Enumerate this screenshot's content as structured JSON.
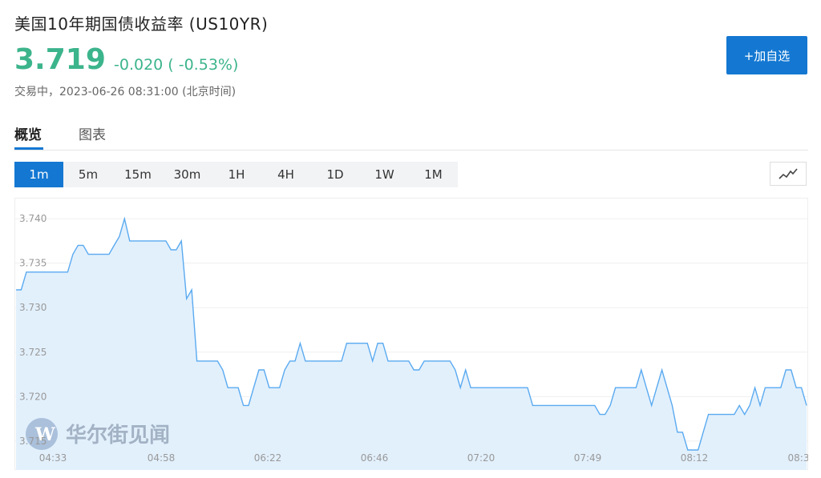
{
  "header": {
    "title": "美国10年期国债收益率 (US10YR)",
    "price": "3.719",
    "change": "-0.020 ( -0.53%)",
    "status": "交易中，2023-06-26 08:31:00 (北京时间)",
    "add_button": "+加自选"
  },
  "tabs": [
    {
      "label": "概览",
      "active": true
    },
    {
      "label": "图表",
      "active": false
    }
  ],
  "periods": [
    {
      "label": "1m",
      "active": true
    },
    {
      "label": "5m",
      "active": false
    },
    {
      "label": "15m",
      "active": false
    },
    {
      "label": "30m",
      "active": false
    },
    {
      "label": "1H",
      "active": false
    },
    {
      "label": "4H",
      "active": false
    },
    {
      "label": "1D",
      "active": false
    },
    {
      "label": "1W",
      "active": false
    },
    {
      "label": "1M",
      "active": false
    }
  ],
  "chart_toggle_icon": "line-chart-icon",
  "watermark": "华尔街见闻",
  "colors": {
    "up_down": "#3cb48c",
    "accent": "#1478d2",
    "line": "#5aaaf0",
    "fill": "#e2f0fc"
  },
  "chart_data": {
    "type": "area",
    "title": "",
    "xlabel": "",
    "ylabel": "",
    "ylim": [
      3.714,
      3.741
    ],
    "yticks": [
      "3.740",
      "3.735",
      "3.730",
      "3.725",
      "3.720",
      "3.715"
    ],
    "xticks": [
      "04:33",
      "04:58",
      "06:22",
      "06:46",
      "07:20",
      "07:49",
      "08:12",
      "08:3"
    ],
    "grid": true,
    "values": [
      3.732,
      3.732,
      3.734,
      3.734,
      3.734,
      3.734,
      3.734,
      3.734,
      3.734,
      3.734,
      3.734,
      3.736,
      3.737,
      3.737,
      3.736,
      3.736,
      3.736,
      3.736,
      3.736,
      3.737,
      3.738,
      3.74,
      3.7375,
      3.7375,
      3.7375,
      3.7375,
      3.7375,
      3.7375,
      3.7375,
      3.7375,
      3.7365,
      3.7365,
      3.7375,
      3.731,
      3.732,
      3.724,
      3.724,
      3.724,
      3.724,
      3.724,
      3.723,
      3.721,
      3.721,
      3.721,
      3.719,
      3.719,
      3.721,
      3.723,
      3.723,
      3.721,
      3.721,
      3.721,
      3.723,
      3.724,
      3.724,
      3.726,
      3.724,
      3.724,
      3.724,
      3.724,
      3.724,
      3.724,
      3.724,
      3.724,
      3.726,
      3.726,
      3.726,
      3.726,
      3.726,
      3.724,
      3.726,
      3.726,
      3.724,
      3.724,
      3.724,
      3.724,
      3.724,
      3.723,
      3.723,
      3.724,
      3.724,
      3.724,
      3.724,
      3.724,
      3.724,
      3.723,
      3.721,
      3.723,
      3.721,
      3.721,
      3.721,
      3.721,
      3.721,
      3.721,
      3.721,
      3.721,
      3.721,
      3.721,
      3.721,
      3.721,
      3.719,
      3.719,
      3.719,
      3.719,
      3.719,
      3.719,
      3.719,
      3.719,
      3.719,
      3.719,
      3.719,
      3.719,
      3.719,
      3.718,
      3.718,
      3.719,
      3.721,
      3.721,
      3.721,
      3.721,
      3.721,
      3.723,
      3.721,
      3.719,
      3.721,
      3.723,
      3.721,
      3.719,
      3.716,
      3.716,
      3.714,
      3.714,
      3.714,
      3.716,
      3.718,
      3.718,
      3.718,
      3.718,
      3.718,
      3.718,
      3.719,
      3.718,
      3.719,
      3.721,
      3.719,
      3.721,
      3.721,
      3.721,
      3.721,
      3.723,
      3.723,
      3.721,
      3.721,
      3.719
    ]
  }
}
